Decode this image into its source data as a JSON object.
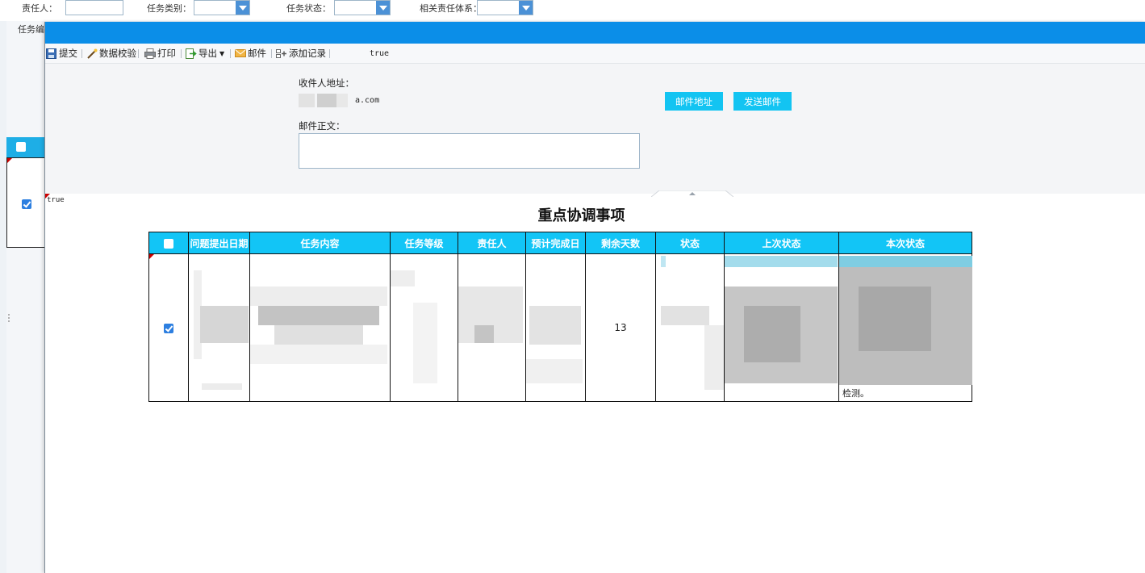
{
  "filters": {
    "owner_label": "责任人：",
    "task_type_label": "任务类别：",
    "task_status_label": "任务状态：",
    "system_label": "相关责任体系：",
    "task_no_label": "任务编"
  },
  "dialog": {
    "toolbar": {
      "submit": "提交",
      "validate": "数据校验",
      "print": "打印",
      "export": "导出",
      "email": "邮件",
      "add_record": "添加记录",
      "flag": "true"
    },
    "mail": {
      "recipient_label": "收件人地址：",
      "recipient_value_suffix": "a.com",
      "body_label": "邮件正文：",
      "address_button": "邮件地址",
      "send_button": "发送邮件"
    },
    "side_flag": "true",
    "report": {
      "title": "重点协调事项",
      "columns": [
        "问题提出日期",
        "任务内容",
        "任务等级",
        "责任人",
        "预计完成日",
        "剩余天数",
        "状态",
        "上次状态",
        "本次状态"
      ],
      "row": {
        "checked": true,
        "remaining_days": "13",
        "current_status_tail": "检测。"
      }
    }
  },
  "colors": {
    "title_bar": "#0b8ee8",
    "header_cyan": "#12c5f6",
    "button": "#13c4f2",
    "checkbox": "#2d7fe0"
  }
}
